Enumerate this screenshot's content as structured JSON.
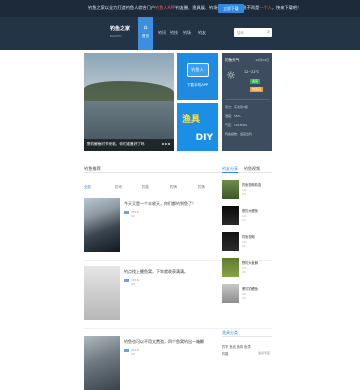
{
  "notice": {
    "text_pre": "钓鱼之家以全力打造钓鱼人综合门户",
    "text_hl": "钓鱼人APP",
    "text_post": "钓友圈、渔具展、钓场查询，从此钓鱼不再是",
    "text_hl2": "一个人",
    "text_end": "，快来下载吧！",
    "button": "立即下载"
  },
  "nav": {
    "logo_main": "钓鱼之家",
    "logo_sub": "DIAOYU",
    "home_label": "首页",
    "items": [
      "钓讯",
      "钓技",
      "钓场",
      "钓友"
    ],
    "search_placeholder": "搜索"
  },
  "banner": {
    "caption": "野钓鲫鱼时节来临，你们准备好了吗"
  },
  "promo1": {
    "badge": "钓鱼人",
    "sub": "下载手机APP"
  },
  "promo2": {
    "t1": "渔具",
    "t2": "DIY"
  },
  "weather": {
    "city": "钓鱼天气",
    "date": "10月24日",
    "temp": "12~22℃",
    "badge1": "适宜",
    "badge2": "较适宜",
    "rows": [
      "风力：东北风3级",
      "湿度：58%",
      "气压：1018hPa",
      "钓鱼指数：适宜出钓"
    ],
    "badge1_color": "#2fb14a",
    "badge2_color": "#f1a12b"
  },
  "section": {
    "title": "钓鱼推荐",
    "filters": [
      "全部",
      "钓讯",
      "钓技",
      "钓饵",
      "钓场",
      "渔具"
    ]
  },
  "posts": [
    {
      "title": "今天又是一个丰收天，你们都钓到鱼了！",
      "date": "2016-10"
    },
    {
      "title": "钓点找上鲤鱼窝，下竿就收获满满。",
      "date": "2016-10"
    },
    {
      "title": "钓鱼也可以不用太费劲，四个鱼窝钓出一箱鲫",
      "date": "2016-10"
    }
  ],
  "sidebar": {
    "tab_active": "钓友分享",
    "tab_other": "钓鱼视频",
    "items": [
      {
        "title": "钓鱼视频精选",
        "date": "10-24"
      },
      {
        "title": "夜钓大鲤鱼",
        "date": "10-22"
      },
      {
        "title": "钓鱼视频",
        "date": "10-21"
      },
      {
        "title": "野钓大板鲫",
        "date": "10-20"
      },
      {
        "title": "黑坑钓鲤鱼",
        "date": "10-19"
      }
    ],
    "section2_title": "渔具分类",
    "section2_row": "钓竿 鱼线 鱼钩 鱼漂",
    "section2_row2": "钓箱",
    "section2_val": "渔具专区"
  }
}
